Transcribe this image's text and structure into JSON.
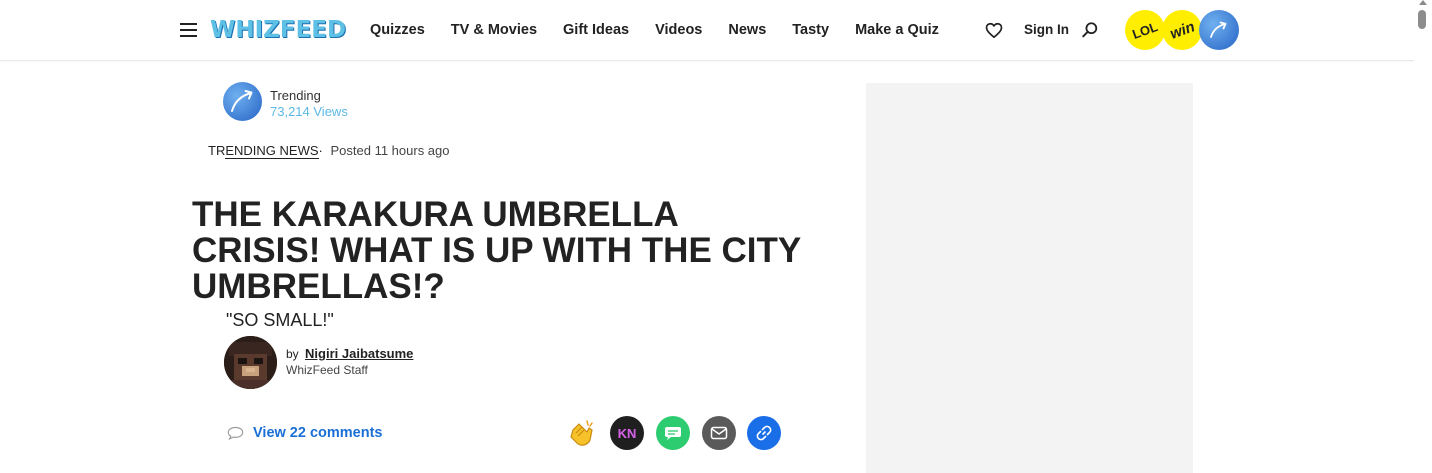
{
  "header": {
    "logo_text": "WHIZFEED",
    "nav": [
      "Quizzes",
      "TV & Movies",
      "Gift Ideas",
      "Videos",
      "News",
      "Tasty",
      "Make a Quiz"
    ],
    "sign_in": "Sign In",
    "badges": {
      "lol": "LOL",
      "win": "win"
    }
  },
  "article": {
    "trending_label": "Trending",
    "views": "73,214 Views",
    "category_prefix": "TR",
    "category_underlined": "ENDING NEWS",
    "category_sep": "·",
    "posted": "Posted 11 hours ago",
    "title": "THE KARAKURA UMBRELLA CRISIS! WHAT IS UP WITH THE CITY UMBRELLAS!?",
    "subtitle": "\"SO SMALL!\"",
    "by_label": "by",
    "author": "Nigiri Jaibatsume",
    "author_role": "WhizFeed Staff",
    "comments": "View 22 comments",
    "share_kn_label": "KN"
  },
  "colors": {
    "logo": "#5ec0e4",
    "link_blue": "#1a6fd6",
    "views": "#5cb8e6",
    "badge_yellow": "#ffee00",
    "ad_bg": "#f3f3f3"
  },
  "icons": [
    "hamburger-icon",
    "heart-icon",
    "search-icon",
    "trending-arrow-icon",
    "comment-bubble-icon",
    "clap-icon",
    "message-icon",
    "mail-icon",
    "link-icon"
  ]
}
